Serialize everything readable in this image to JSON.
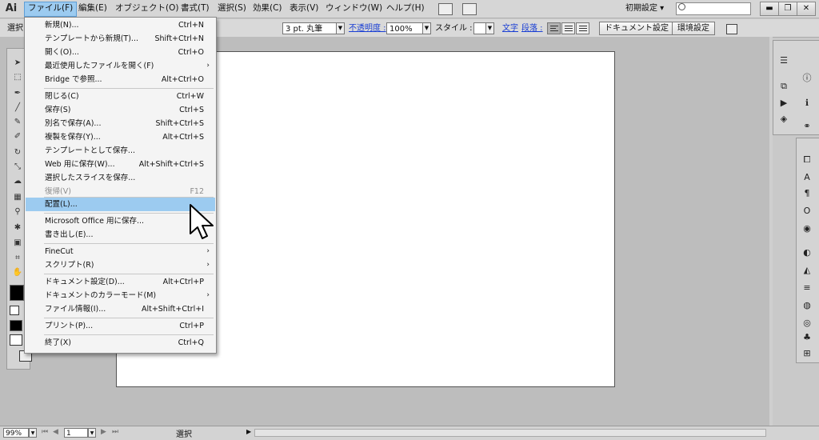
{
  "app": {
    "logo": "Ai"
  },
  "menubar": {
    "items": [
      "ファイル(F)",
      "編集(E)",
      "オブジェクト(O)",
      "書式(T)",
      "選択(S)",
      "効果(C)",
      "表示(V)",
      "ウィンドウ(W)",
      "ヘルプ(H)"
    ],
    "active_index": 0,
    "workspace": "初期設定 ▾",
    "search_placeholder": ""
  },
  "window_controls": {
    "minimize": "▬",
    "restore": "❐",
    "close": "✕"
  },
  "controlbar": {
    "selection_label": "選択",
    "stroke_profile": "3 pt. 丸筆",
    "opacity_label": "不透明度 :",
    "opacity_value": "100%",
    "style_label": "スタイル :",
    "text_link": "文字",
    "paragraph_link": "段落 :",
    "document_setup_button": "ドキュメント設定",
    "preferences_button": "環境設定"
  },
  "file_menu": {
    "items": [
      {
        "label": "新規(N)...",
        "shortcut": "Ctrl+N"
      },
      {
        "label": "テンプレートから新規(T)...",
        "shortcut": "Shift+Ctrl+N"
      },
      {
        "label": "開く(O)...",
        "shortcut": "Ctrl+O"
      },
      {
        "label": "最近使用したファイルを開く(F)",
        "shortcut": "",
        "submenu": "›"
      },
      {
        "label": "Bridge で参照...",
        "shortcut": "Alt+Ctrl+O"
      },
      {
        "label": "閉じる(C)",
        "shortcut": "Ctrl+W"
      },
      {
        "label": "保存(S)",
        "shortcut": "Ctrl+S"
      },
      {
        "label": "別名で保存(A)...",
        "shortcut": "Shift+Ctrl+S"
      },
      {
        "label": "複製を保存(Y)...",
        "shortcut": "Alt+Ctrl+S"
      },
      {
        "label": "テンプレートとして保存...",
        "shortcut": ""
      },
      {
        "label": "Web 用に保存(W)...",
        "shortcut": "Alt+Shift+Ctrl+S"
      },
      {
        "label": "選択したスライスを保存...",
        "shortcut": ""
      },
      {
        "label": "復帰(V)",
        "shortcut": "F12",
        "disabled": true
      },
      {
        "label": "配置(L)...",
        "shortcut": "",
        "highlighted": true
      },
      {
        "label": "Microsoft Office 用に保存...",
        "shortcut": ""
      },
      {
        "label": "書き出し(E)...",
        "shortcut": ""
      },
      {
        "label": "FineCut",
        "shortcut": "",
        "submenu": "›"
      },
      {
        "label": "スクリプト(R)",
        "shortcut": "",
        "submenu": "›"
      },
      {
        "label": "ドキュメント設定(D)...",
        "shortcut": "Alt+Ctrl+P"
      },
      {
        "label": "ドキュメントのカラーモード(M)",
        "shortcut": "",
        "submenu": "›"
      },
      {
        "label": "ファイル情報(I)...",
        "shortcut": "Alt+Shift+Ctrl+I"
      },
      {
        "label": "プリント(P)...",
        "shortcut": "Ctrl+P"
      },
      {
        "label": "終了(X)",
        "shortcut": "Ctrl+Q"
      }
    ]
  },
  "statusbar": {
    "zoom": "99%",
    "page": "1",
    "status": "選択"
  }
}
